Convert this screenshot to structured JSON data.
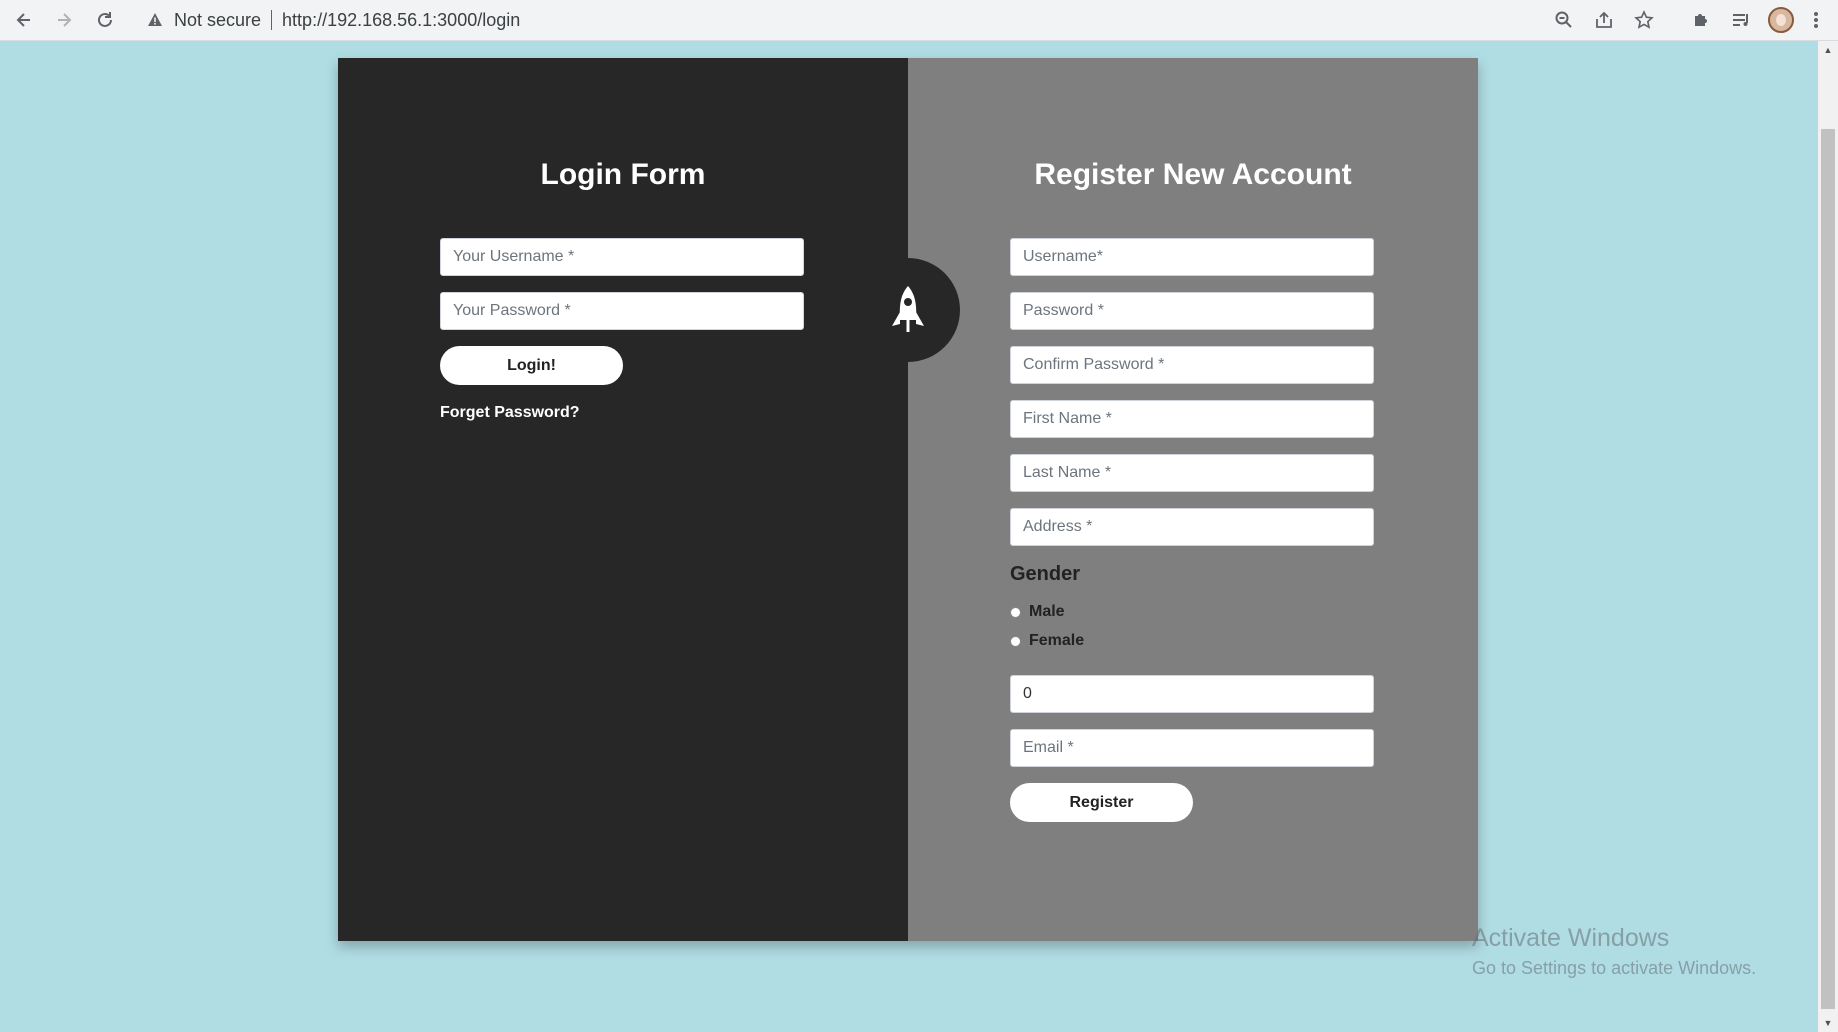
{
  "browser": {
    "security_label": "Not secure",
    "url": "http://192.168.56.1:3000/login"
  },
  "icons": {
    "back": "arrow-left-icon",
    "forward": "arrow-right-icon",
    "reload": "reload-icon",
    "warning": "warning-triangle-icon",
    "zoom": "zoom-out-icon",
    "share": "share-icon",
    "bookmark": "star-icon",
    "extensions": "puzzle-icon",
    "reading_list": "reading-list-icon",
    "profile": "avatar",
    "menu": "kebab-menu-icon",
    "badge": "rocket-icon"
  },
  "login": {
    "title": "Login Form",
    "username_placeholder": "Your Username *",
    "password_placeholder": "Your Password *",
    "submit_label": "Login!",
    "forgot_label": "Forget Password?"
  },
  "register": {
    "title": "Register New Account",
    "username_placeholder": "Username*",
    "password_placeholder": "Password *",
    "confirm_placeholder": "Confirm Password *",
    "first_name_placeholder": "First Name *",
    "last_name_placeholder": "Last Name *",
    "address_placeholder": "Address *",
    "gender_label": "Gender",
    "gender_options": [
      "Male",
      "Female"
    ],
    "number_value": "0",
    "email_placeholder": "Email *",
    "submit_label": "Register"
  },
  "watermark": {
    "line1": "Activate Windows",
    "line2": "Go to Settings to activate Windows."
  },
  "colors": {
    "page_bg": "#b0dde4",
    "login_panel": "#282727",
    "register_panel": "#7f7f7f"
  }
}
